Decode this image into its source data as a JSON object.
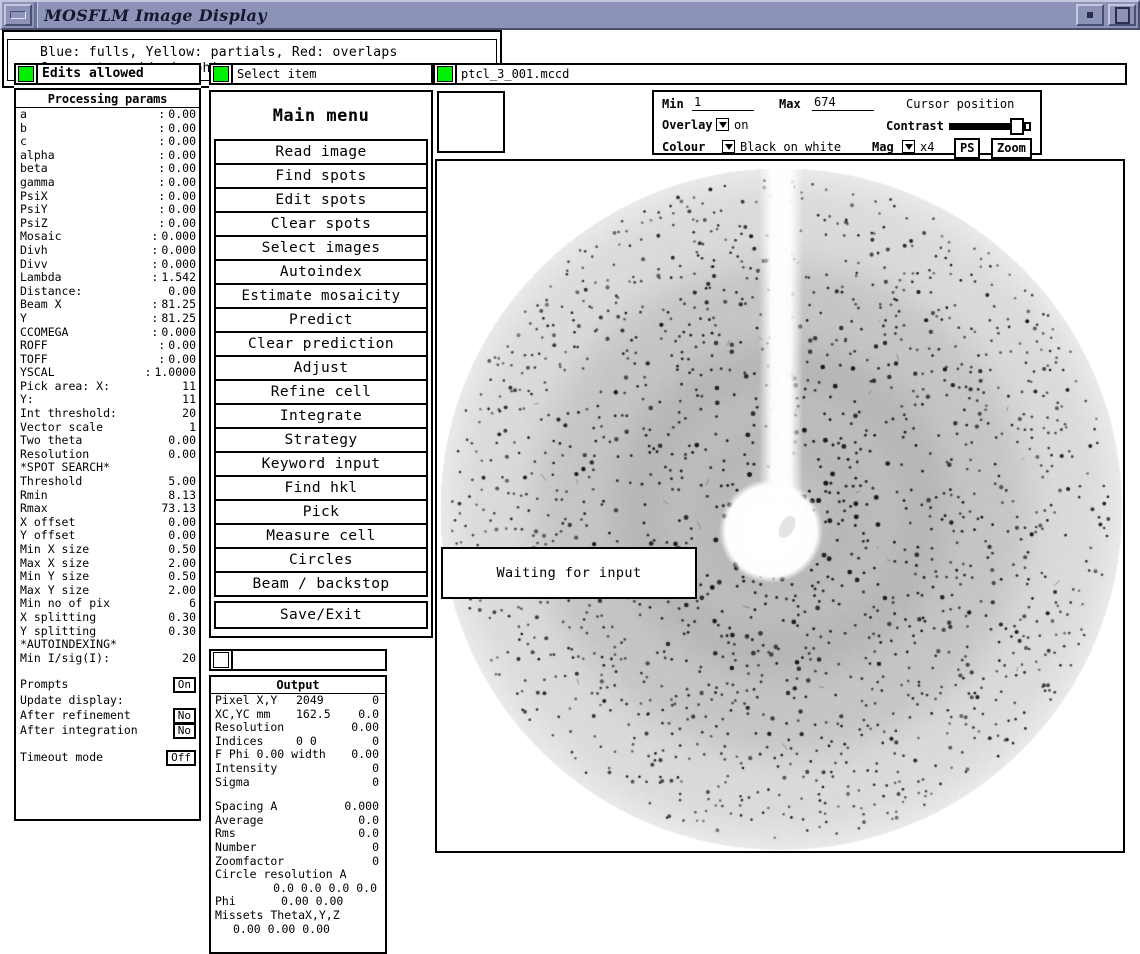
{
  "window": {
    "title": "MOSFLM Image Display",
    "buttons": {
      "minimize": "minimize-button",
      "shade": "shade-button",
      "maximize": "maximize-button"
    }
  },
  "left_panel": {
    "status_label": "Edits allowed",
    "status_led_color": "#00ee00",
    "title": "Processing params",
    "rows": [
      {
        "label": "a",
        "colon": ":",
        "value": "0.00"
      },
      {
        "label": "b",
        "colon": ":",
        "value": "0.00"
      },
      {
        "label": "c",
        "colon": ":",
        "value": "0.00"
      },
      {
        "label": "alpha",
        "colon": ":",
        "value": "0.00"
      },
      {
        "label": "beta",
        "colon": ":",
        "value": "0.00"
      },
      {
        "label": "gamma",
        "colon": ":",
        "value": "0.00"
      },
      {
        "label": "PsiX",
        "colon": ":",
        "value": "0.00"
      },
      {
        "label": "PsiY",
        "colon": ":",
        "value": "0.00"
      },
      {
        "label": "PsiZ",
        "colon": ":",
        "value": "0.00"
      },
      {
        "label": "Mosaic",
        "colon": ":",
        "value": "0.000"
      },
      {
        "label": "Divh",
        "colon": ":",
        "value": "0.000"
      },
      {
        "label": "Divv",
        "colon": ":",
        "value": "0.000"
      },
      {
        "label": "Lambda",
        "colon": ":",
        "value": "1.542"
      },
      {
        "label": "Distance:",
        "colon": "",
        "value": "0.00"
      },
      {
        "label": "Beam X",
        "colon": ":",
        "value": "81.25"
      },
      {
        "label": "     Y",
        "colon": ":",
        "value": "81.25"
      },
      {
        "label": "CCOMEGA",
        "colon": ":",
        "value": "0.000"
      },
      {
        "label": "ROFF",
        "colon": ":",
        "value": "0.00"
      },
      {
        "label": "TOFF",
        "colon": ":",
        "value": "0.00"
      },
      {
        "label": "YSCAL",
        "colon": ":",
        "value": "1.0000"
      },
      {
        "label": "Pick area: X:",
        "colon": "",
        "value": "11"
      },
      {
        "label": "           Y:",
        "colon": "",
        "value": "11"
      },
      {
        "label": "Int threshold:",
        "colon": "",
        "value": "20"
      },
      {
        "label": "Vector scale",
        "colon": "",
        "value": "1"
      },
      {
        "label": "Two theta",
        "colon": "",
        "value": "0.00"
      },
      {
        "label": "Resolution",
        "colon": "",
        "value": "0.00"
      },
      {
        "label": "*SPOT SEARCH*",
        "colon": "",
        "value": ""
      },
      {
        "label": "Threshold",
        "colon": "",
        "value": "5.00"
      },
      {
        "label": "Rmin",
        "colon": "",
        "value": "8.13"
      },
      {
        "label": "Rmax",
        "colon": "",
        "value": "73.13"
      },
      {
        "label": "X offset",
        "colon": "",
        "value": "0.00"
      },
      {
        "label": "Y offset",
        "colon": "",
        "value": "0.00"
      },
      {
        "label": "Min X size",
        "colon": "",
        "value": "0.50"
      },
      {
        "label": "Max X size",
        "colon": "",
        "value": "2.00"
      },
      {
        "label": "Min Y size",
        "colon": "",
        "value": "0.50"
      },
      {
        "label": "Max Y size",
        "colon": "",
        "value": "2.00"
      },
      {
        "label": "Min no of pix",
        "colon": "",
        "value": "6"
      },
      {
        "label": "X splitting",
        "colon": "",
        "value": "0.30"
      },
      {
        "label": "Y splitting",
        "colon": "",
        "value": "0.30"
      },
      {
        "label": "*AUTOINDEXING*",
        "colon": "",
        "value": ""
      },
      {
        "label": "Min I/sig(I):",
        "colon": "",
        "value": "20"
      }
    ],
    "toggles": [
      {
        "label": "Prompts",
        "value": "On"
      },
      {
        "label": "Update display:",
        "value": ""
      },
      {
        "label": "After refinement",
        "value": "No"
      },
      {
        "label": "After integration",
        "value": "No"
      },
      {
        "label": "Timeout mode",
        "value": "Off"
      }
    ]
  },
  "menu_panel": {
    "status_label": "Select item",
    "title": "Main menu",
    "items": [
      "Read image",
      "Find spots",
      "Edit spots",
      "Clear spots",
      "Select images",
      "Autoindex",
      "Estimate mosaicity",
      "Predict",
      "Clear prediction",
      "Adjust",
      "Refine cell",
      "Integrate",
      "Strategy",
      "Keyword input",
      "Find hkl",
      "Pick",
      "Measure cell",
      "Circles",
      "Beam / backstop"
    ],
    "exit_item": "Save/Exit"
  },
  "output_panel": {
    "status_label": "",
    "title": "Output",
    "rows": [
      {
        "label": "Pixel X,Y",
        "mid": "2049",
        "right": "0"
      },
      {
        "label": "XC,YC mm",
        "mid": "162.5",
        "right": "0.0"
      },
      {
        "label": "Resolution",
        "mid": "",
        "right": "0.00"
      },
      {
        "label": "Indices",
        "mid": "0    0",
        "right": "0"
      },
      {
        "label": "F Phi   0.00 width",
        "mid": "",
        "right": "0.00"
      },
      {
        "label": "Intensity",
        "mid": "",
        "right": "0"
      },
      {
        "label": "Sigma",
        "mid": "",
        "right": "0"
      }
    ],
    "rows2": [
      {
        "label": "Spacing  A",
        "mid": "",
        "right": "0.000"
      },
      {
        "label": "Average",
        "mid": "",
        "right": "0.0"
      },
      {
        "label": "Rms",
        "mid": "",
        "right": "0.0"
      },
      {
        "label": "Number",
        "mid": "",
        "right": "0"
      },
      {
        "label": "Zoomfactor",
        "mid": "",
        "right": "0"
      }
    ],
    "circle_res_label": "Circle resolution A",
    "circle_res_values": "0.0   0.0   0.0   0.0",
    "phi_label": "Phi",
    "phi_values": "0.00      0.00",
    "missets_label": "Missets ThetaX,Y,Z",
    "missets_values": "0.00   0.00   0.00"
  },
  "image_panel": {
    "filename": "ptcl_3_001.mccd",
    "controls": {
      "min_label": "Min",
      "min_value": "1",
      "max_label": "Max",
      "max_value": "674",
      "cursor_position_label": "Cursor position",
      "overlay_label": "Overlay",
      "overlay_value": "on",
      "contrast_label": "Contrast",
      "colour_label": "Colour",
      "colour_value": "Black on white",
      "mag_label": "Mag",
      "mag_value": "x4",
      "ps_button": "PS",
      "zoom_button": "Zoom"
    },
    "waiting_message": "Waiting for input"
  },
  "legend": {
    "line1": "Blue: fulls, Yellow: partials, Red: overlaps",
    "line2": "Green: too wide in phi"
  }
}
